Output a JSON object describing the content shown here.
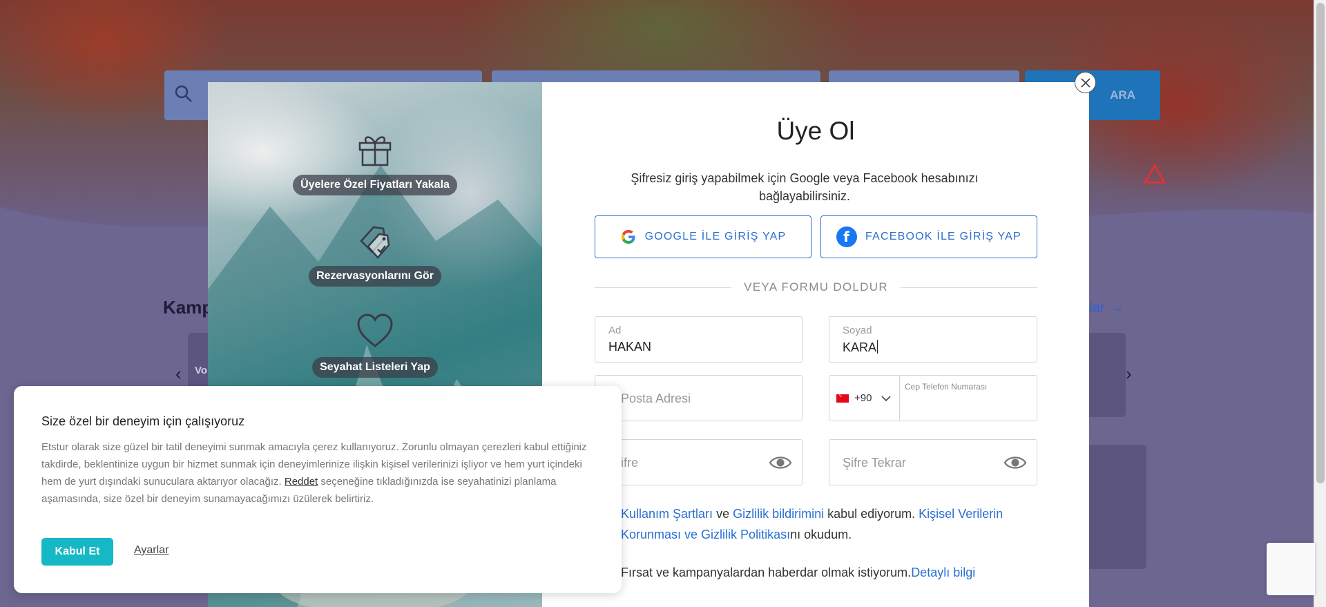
{
  "background": {
    "search_button": "ARA",
    "section_title": "Kamp",
    "all_link": "nyalar",
    "card_text": "Vo"
  },
  "modal": {
    "benefits": [
      {
        "label": "Üyelere Özel Fiyatları Yakala",
        "icon": "gift-icon"
      },
      {
        "label": "Rezervasyonlarını Gör",
        "icon": "tags-icon"
      },
      {
        "label": "Seyahat Listeleri Yap",
        "icon": "heart-icon"
      }
    ],
    "title": "Üye Ol",
    "subtitle": "Şifresiz giriş yapabilmek için Google veya Facebook hesabınızı bağlayabilirsiniz.",
    "google_button": "GOOGLE İLE GİRİŞ YAP",
    "facebook_button": "FACEBOOK İLE GİRİŞ YAP",
    "divider": "VEYA FORMU DOLDUR",
    "fields": {
      "first_name": {
        "label": "Ad",
        "value": "HAKAN"
      },
      "last_name": {
        "label": "Soyad",
        "value": "KARA"
      },
      "email": {
        "placeholder": "Posta Adresi"
      },
      "phone": {
        "country_code": "+90",
        "label": "Cep Telefon Numarası"
      },
      "password": {
        "placeholder": "ifre"
      },
      "password_repeat": {
        "placeholder": "Şifre Tekrar"
      }
    },
    "terms": {
      "link1": "Kullanım Şartları",
      "text1": " ve ",
      "link2": "Gizlilik bildirimini",
      "text2": " kabul ediyorum. ",
      "link3": "Kişisel Verilerin Korunması ve Gizlilik Politikası",
      "text3": "nı okudum."
    },
    "promo": {
      "text": "Fırsat ve kampanyalardan haberdar olmak istiyorum.",
      "link": "Detaylı bilgi"
    }
  },
  "cookie": {
    "title": "Size özel bir deneyim için çalışıyoruz",
    "text_before": "Etstur olarak size güzel bir tatil deneyimi sunmak amacıyla çerez kullanıyoruz. Zorunlu olmayan çerezleri kabul ettiğiniz takdirde, beklentinize uygun bir hizmet sunmak için deneyimlerinize ilişkin kişisel verilerinizi işliyor ve hem yurt içindeki hem de yurt dışındaki sunuculara aktarıyor olacağız. ",
    "reject_link": "Reddet",
    "text_after": " seçeneğine tıkladığınızda ise seyahatinizi planlama aşamasında, size özel bir deneyim sunamayacağımızı üzülerek belirtiriz.",
    "accept_button": "Kabul Et",
    "settings_link": "Ayarlar"
  },
  "colors": {
    "accent_blue": "#2a6fd1",
    "cookie_accept": "#17b8c6",
    "facebook": "#1877f2"
  }
}
